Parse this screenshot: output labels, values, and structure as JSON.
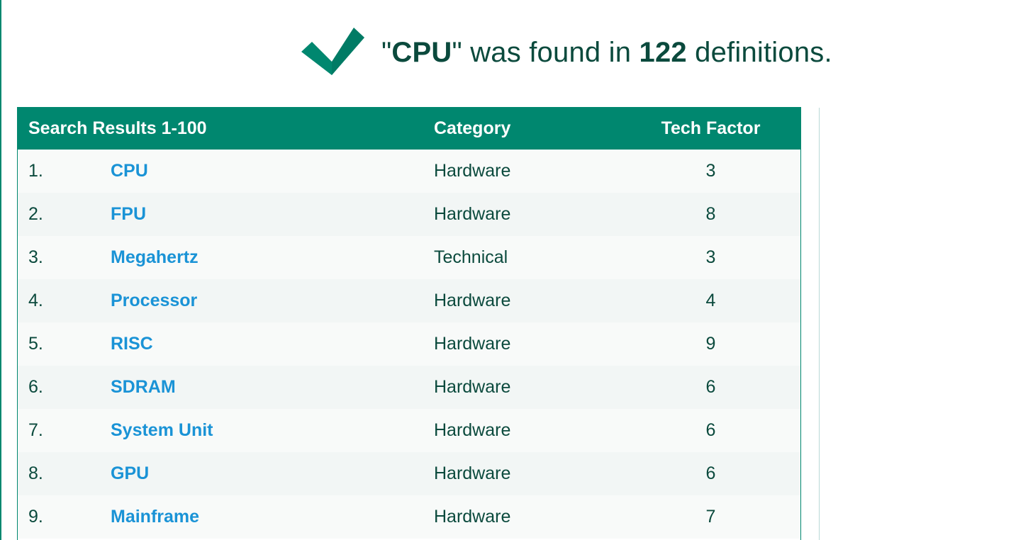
{
  "summary": {
    "quote_open": "\"",
    "query": "CPU",
    "quote_close": "\"",
    "found_text": " was found in ",
    "count": "122",
    "definitions_text": " definitions."
  },
  "table": {
    "headers": {
      "results": "Search Results 1-100",
      "category": "Category",
      "tech_factor": "Tech Factor"
    },
    "rows": [
      {
        "num": "1.",
        "term": "CPU",
        "category": "Hardware",
        "factor": "3"
      },
      {
        "num": "2.",
        "term": "FPU",
        "category": "Hardware",
        "factor": "8"
      },
      {
        "num": "3.",
        "term": "Megahertz",
        "category": "Technical",
        "factor": "3"
      },
      {
        "num": "4.",
        "term": "Processor",
        "category": "Hardware",
        "factor": "4"
      },
      {
        "num": "5.",
        "term": "RISC",
        "category": "Hardware",
        "factor": "9"
      },
      {
        "num": "6.",
        "term": "SDRAM",
        "category": "Hardware",
        "factor": "6"
      },
      {
        "num": "7.",
        "term": "System Unit",
        "category": "Hardware",
        "factor": "6"
      },
      {
        "num": "8.",
        "term": "GPU",
        "category": "Hardware",
        "factor": "6"
      },
      {
        "num": "9.",
        "term": "Mainframe",
        "category": "Hardware",
        "factor": "7"
      }
    ]
  },
  "icons": {
    "success": "checkmark-icon"
  },
  "colors": {
    "accent": "#00876f",
    "heading_text": "#0b4a3d",
    "link": "#1a93d6"
  }
}
